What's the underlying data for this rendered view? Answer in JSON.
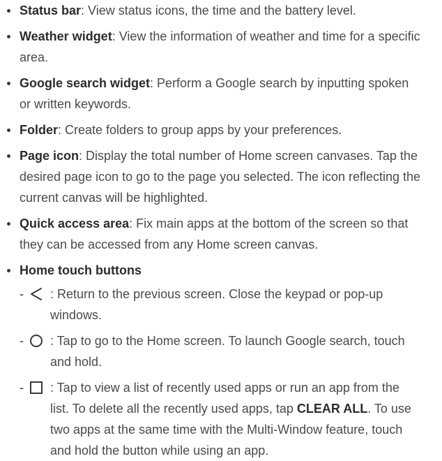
{
  "items": [
    {
      "term": "Status bar",
      "desc": ": View status icons, the time and the battery level."
    },
    {
      "term": "Weather widget",
      "desc": ": View the information of weather and time for a specific area."
    },
    {
      "term": "Google search widget",
      "desc": ": Perform a Google search by inputting spoken or written keywords."
    },
    {
      "term": "Folder",
      "desc": ": Create folders to group apps by your preferences."
    },
    {
      "term": "Page icon",
      "desc": ": Display the total number of Home screen canvases. Tap the desired page icon to go to the page you selected. The icon reflecting the current canvas will be highlighted."
    },
    {
      "term": "Quick access area",
      "desc": ": Fix main apps at the bottom of the screen so that they can be accessed from any Home screen canvas."
    },
    {
      "term": "Home touch buttons"
    }
  ],
  "touch_buttons": {
    "back": {
      "icon": "back-triangle-icon",
      "text": ": Return to the previous screen. Close the keypad or pop-up windows."
    },
    "home": {
      "icon": "home-circle-icon",
      "text": ": Tap to go to the Home screen. To launch Google search, touch and hold."
    },
    "recent": {
      "icon": "recent-square-icon",
      "text_a": ": Tap to view a list of recently used apps or run an app from the list. To delete all the recently used apps, tap ",
      "clear_all": "CLEAR ALL",
      "text_b": ". To use two apps at the same time with the Multi-Window feature, touch and hold the button while using an app."
    }
  },
  "dash": "-",
  "colors": {
    "text": "#3a3a3a",
    "term": "#2c2c2c"
  }
}
